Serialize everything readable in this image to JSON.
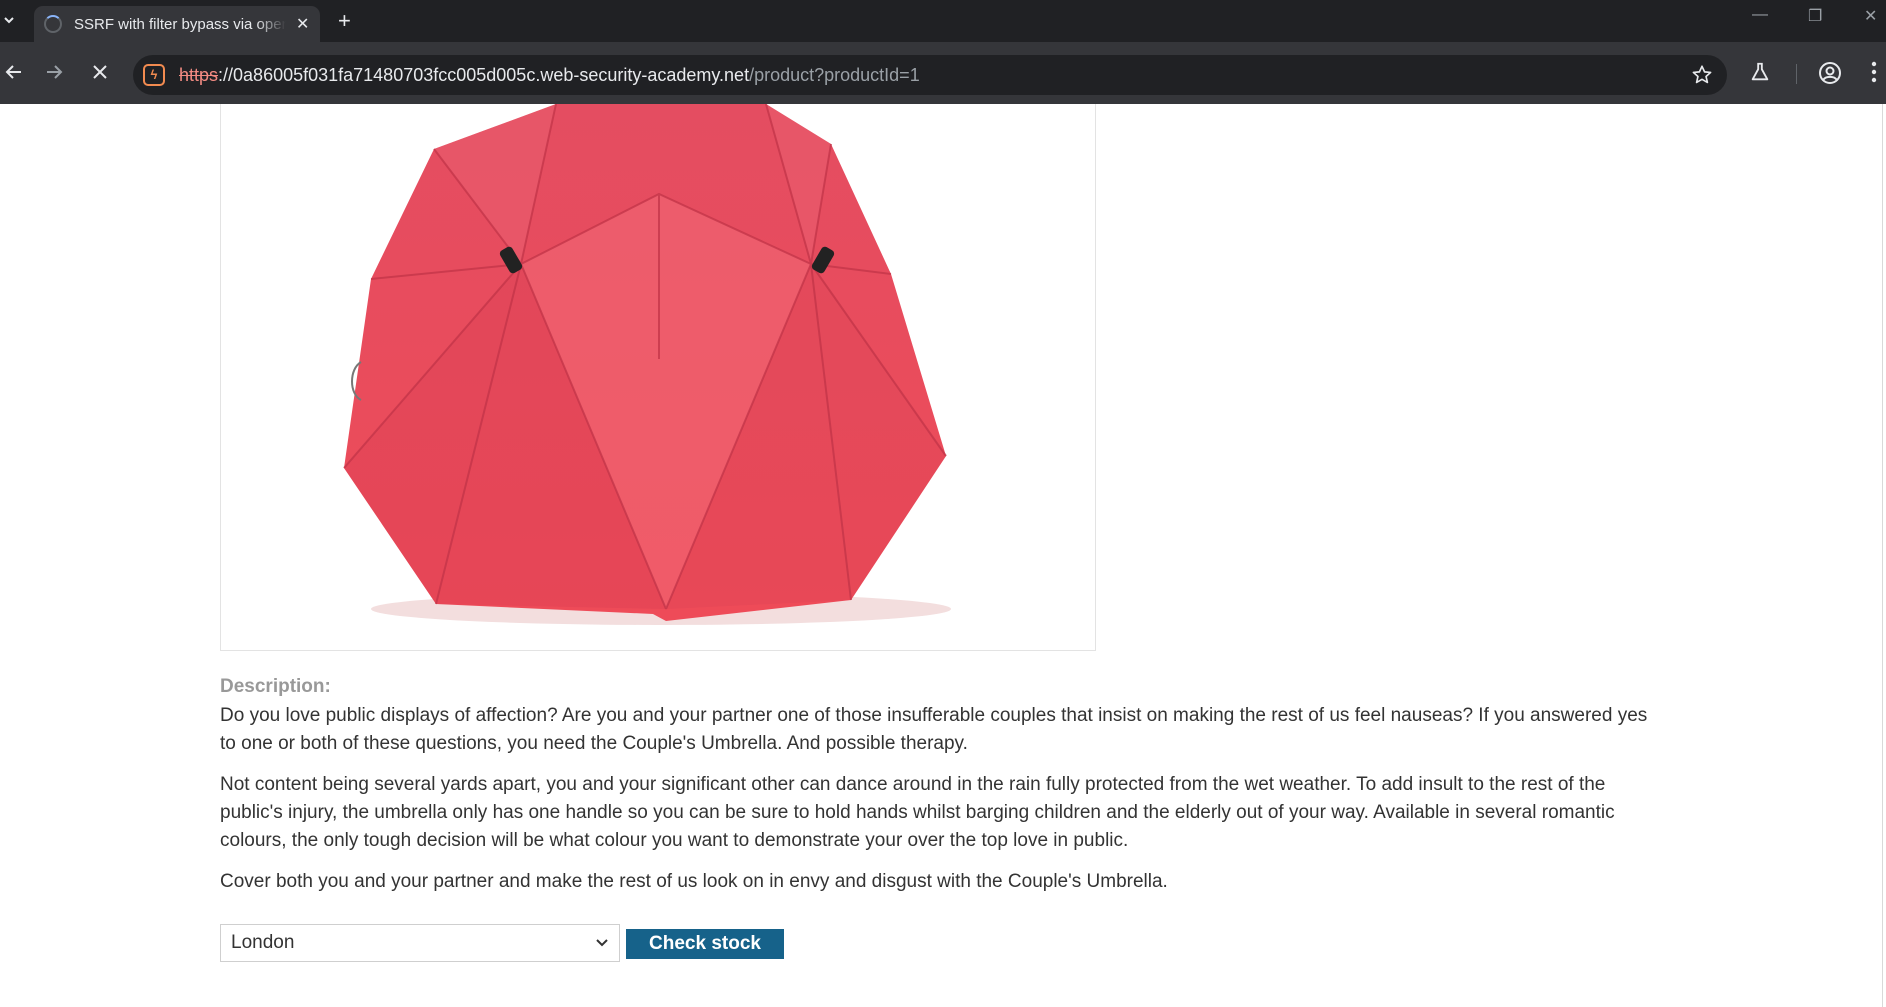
{
  "browser": {
    "tab_title": "SSRF with filter bypass via open redirection vulnerability",
    "url_scheme": "https",
    "url_host": "://0a86005f031fa71480703fcc005d005c.web-security-academy.net",
    "url_path": "/product?productId=1"
  },
  "product": {
    "image_alt": "Couple's Umbrella",
    "description_heading": "Description:",
    "paragraphs": [
      "Do you love public displays of affection? Are you and your partner one of those insufferable couples that insist on making the rest of us feel nauseas? If you answered yes to one or both of these questions, you need the Couple's Umbrella. And possible therapy.",
      "Not content being several yards apart, you and your significant other can dance around in the rain fully protected from the wet weather. To add insult to the rest of the public's injury, the umbrella only has one handle so you can be sure to hold hands whilst barging children and the elderly out of your way. Available in several romantic colours, the only tough decision will be what colour you want to demonstrate your over the top love in public.",
      "Cover both you and your partner and make the rest of us look on in envy and disgust with the Couple's Umbrella."
    ]
  },
  "stock_check": {
    "selected_store": "London",
    "button_label": "Check stock"
  },
  "colors": {
    "button": "#16628a",
    "umbrella": "#e8475a"
  }
}
